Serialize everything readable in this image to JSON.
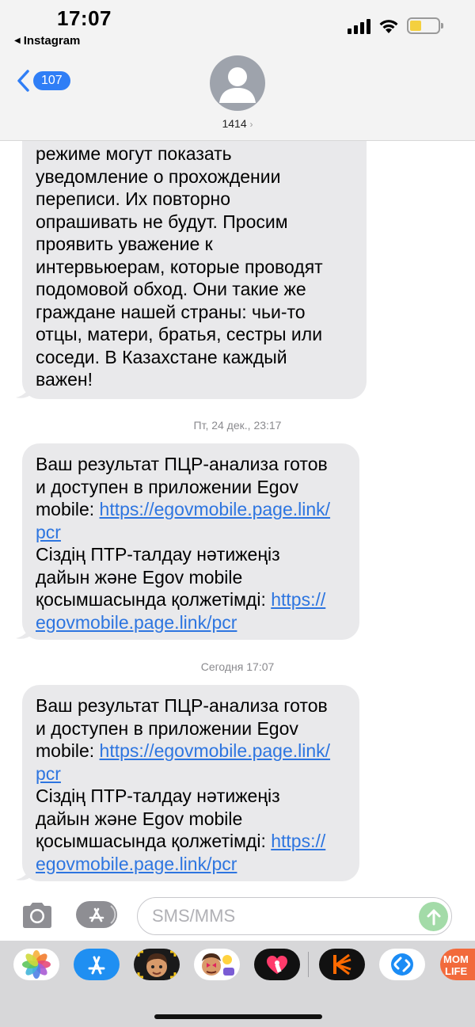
{
  "status_bar": {
    "time": "17:07",
    "back_app": "Instagram"
  },
  "header": {
    "unread_count": "107",
    "contact": "1414"
  },
  "messages": [
    {
      "lines": [
        "режиме могут показать",
        "уведомление о прохождении",
        "переписи. Их повторно",
        "опрашивать не будут. Просим",
        "проявить уважение к",
        "интервьюерам, которые проводят",
        "подомовой обход. Они такие же",
        "граждане нашей страны: чьи-то",
        "отцы, матери, братья, сестры или",
        "соседи. В Казахстане каждый",
        "важен!"
      ]
    },
    {
      "timestamp_day": "Пт, 24 дек.,",
      "timestamp_time": "23:17",
      "line1": "Ваш результат ПЦР-анализа готов",
      "line2": "и доступен в приложении Egov",
      "line3_text": "mobile: ",
      "line3_link": "https://egovmobile.page.link/",
      "line4_link": "pcr",
      "line5": "Сіздің ПТР-талдау нәтижеңіз",
      "line6": "дайын және Egov mobile",
      "line7_text": "қосымшасында қолжетімді: ",
      "line7_link": "https://",
      "line8_link": "egovmobile.page.link/pcr"
    },
    {
      "timestamp_day": "Сегодня",
      "timestamp_time": "17:07",
      "line1": "Ваш результат ПЦР-анализа готов",
      "line2": "и доступен в приложении Egov",
      "line3_text": "mobile: ",
      "line3_link": "https://egovmobile.page.link/",
      "line4_link": "pcr",
      "line5": "Сіздің ПТР-талдау нәтижеңіз",
      "line6": "дайын және Egov mobile",
      "line7_text": "қосымшасында қолжетімді: ",
      "line7_link": "https://",
      "line8_link": "egovmobile.page.link/pcr"
    }
  ],
  "input": {
    "placeholder": "SMS/MMS"
  },
  "app_strip": [
    {
      "icon": "photos-icon"
    },
    {
      "icon": "app-store-icon"
    },
    {
      "icon": "memoji-icon"
    },
    {
      "icon": "animoji-stickers-icon"
    },
    {
      "icon": "digital-touch-heart-icon"
    },
    {
      "icon": "kinopoisk-icon"
    },
    {
      "icon": "shazam-icon"
    },
    {
      "icon": "mom-life-icon",
      "label": "MOM LIFE"
    }
  ],
  "colors": {
    "link": "#2d75e0",
    "badge": "#2f7ef6",
    "bubble": "#e9e9eb",
    "send": "#a3dba8"
  }
}
